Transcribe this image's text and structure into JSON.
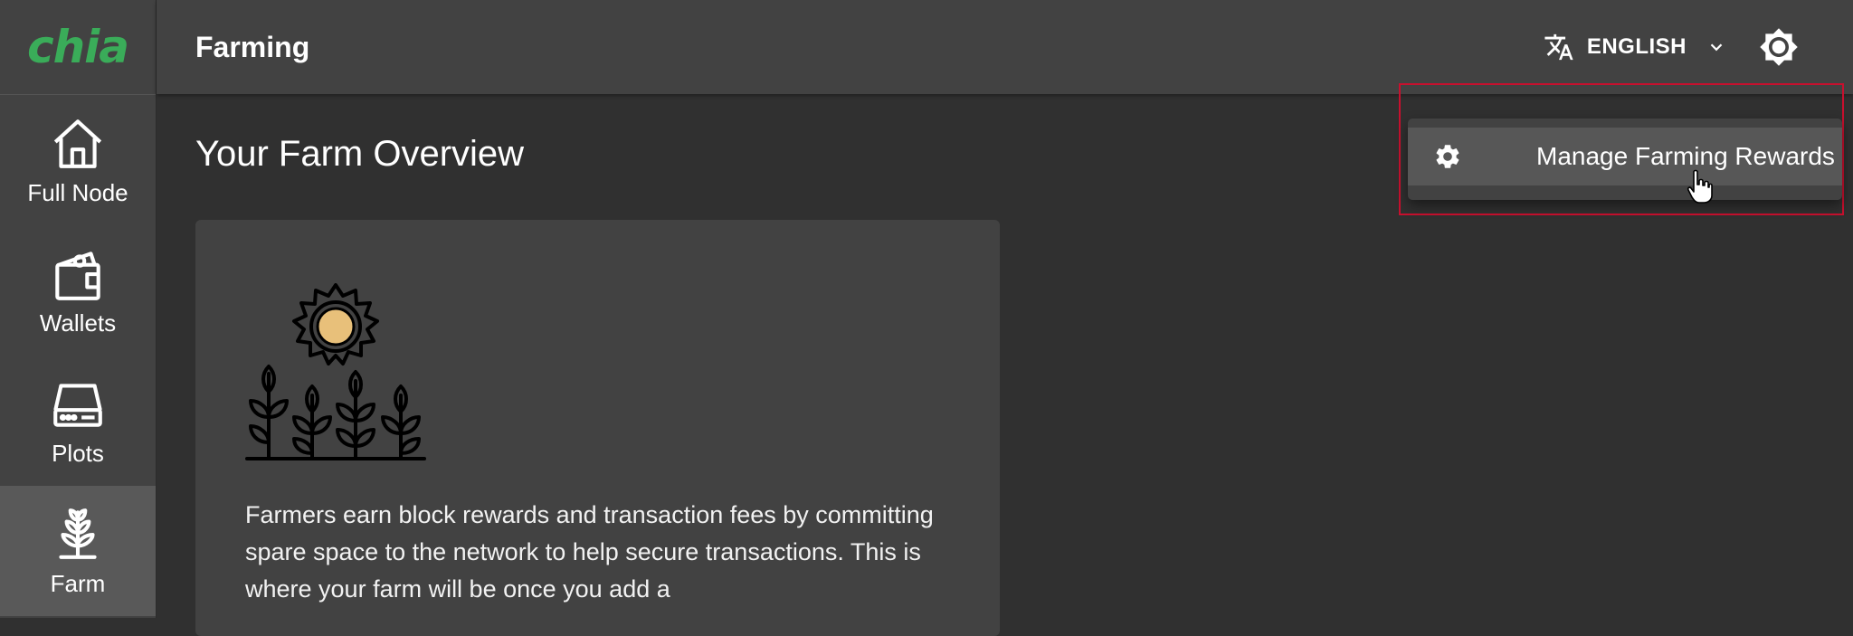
{
  "brand": {
    "logo_text": "chia",
    "color": "#3aac59"
  },
  "sidebar": {
    "items": [
      {
        "label": "Full Node",
        "icon": "home-icon"
      },
      {
        "label": "Wallets",
        "icon": "wallet-icon"
      },
      {
        "label": "Plots",
        "icon": "hard-drive-icon"
      },
      {
        "label": "Farm",
        "icon": "sprout-icon",
        "active": true
      }
    ]
  },
  "header": {
    "title": "Farming",
    "language": "ENGLISH",
    "language_icon": "translate-icon",
    "theme_icon": "brightness-icon"
  },
  "main": {
    "heading": "Your Farm Overview",
    "card": {
      "illustration": "sun-and-plants-illustration",
      "text": "Farmers earn block rewards and transaction fees by committing spare space to the network to help secure transactions. This is where your farm will be once you add a"
    }
  },
  "menu": {
    "items": [
      {
        "label": "Manage Farming Rewards",
        "icon": "gear-icon"
      }
    ]
  },
  "colors": {
    "background": "#303030",
    "surface": "#424242",
    "highlight_border": "#c8102e"
  }
}
